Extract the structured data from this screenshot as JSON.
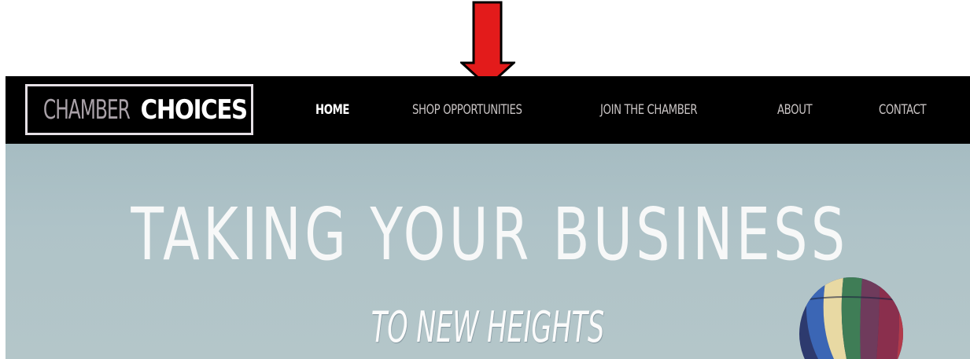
{
  "logo": {
    "part1": "CHAMBER",
    "part2": "CHOICES"
  },
  "nav": {
    "items": [
      {
        "label": "HOME"
      },
      {
        "label": "SHOP OPPORTUNITIES"
      },
      {
        "label": "JOIN THE CHAMBER"
      },
      {
        "label": "ABOUT"
      },
      {
        "label": "CONTACT"
      }
    ]
  },
  "hero": {
    "title": "TAKING YOUR BUSINESS",
    "subtitle": "TO NEW HEIGHTS"
  },
  "colors": {
    "navbar": "#000000",
    "arrow": "#e31b1b",
    "hero_sky": "#afc3c8"
  },
  "icons": {
    "annotation": "red-down-arrow-icon",
    "hero_image": "hot-air-balloon-icon"
  }
}
